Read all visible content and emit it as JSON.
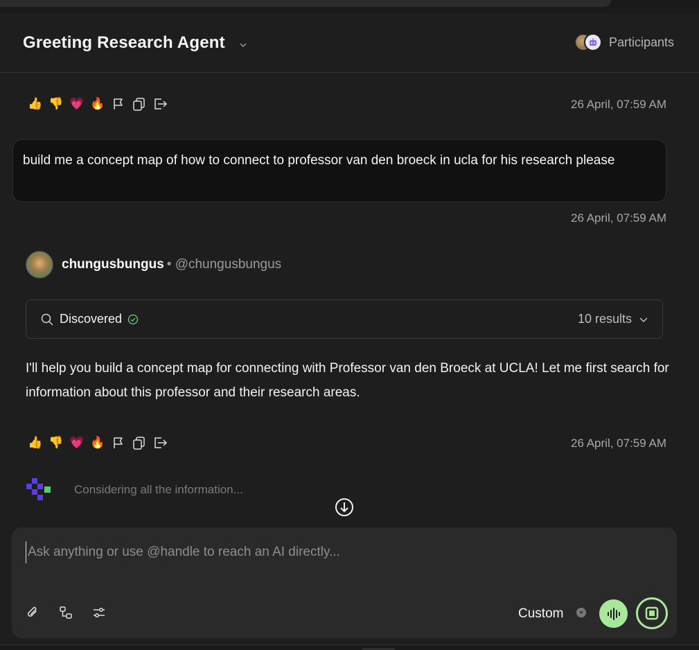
{
  "header": {
    "title": "Greeting Research Agent",
    "participants_label": "Participants"
  },
  "messages": {
    "first_reactions": {
      "timestamp": "26 April, 07:59 AM"
    },
    "user": {
      "text": "build me a concept map of how to connect to professor van den broeck in ucla for his research please",
      "timestamp": "26 April, 07:59 AM"
    },
    "agent": {
      "name": "chungusbungus",
      "handle": "• @chungusbungus",
      "discovered_label": "Discovered",
      "results_count": "10 results",
      "text": "I'll help you build a concept map for connecting with Professor van den Broeck at UCLA! Let me first search for information about this professor and their research areas.",
      "timestamp": "26 April, 07:59 AM"
    },
    "thinking_text": "Considering all the information..."
  },
  "reactions": [
    "👍",
    "👎",
    "💗",
    "🔥"
  ],
  "reaction_icons": [
    "flag-icon",
    "copy-icon",
    "share-icon"
  ],
  "composer": {
    "placeholder": "Ask anything or use @handle to reach an AI directly...",
    "value": "",
    "mode_label": "Custom"
  },
  "colors": {
    "background": "#1e1e1e",
    "accent_green": "#a8e89a",
    "bubble": "#111111",
    "composer": "#2a2a2a"
  }
}
